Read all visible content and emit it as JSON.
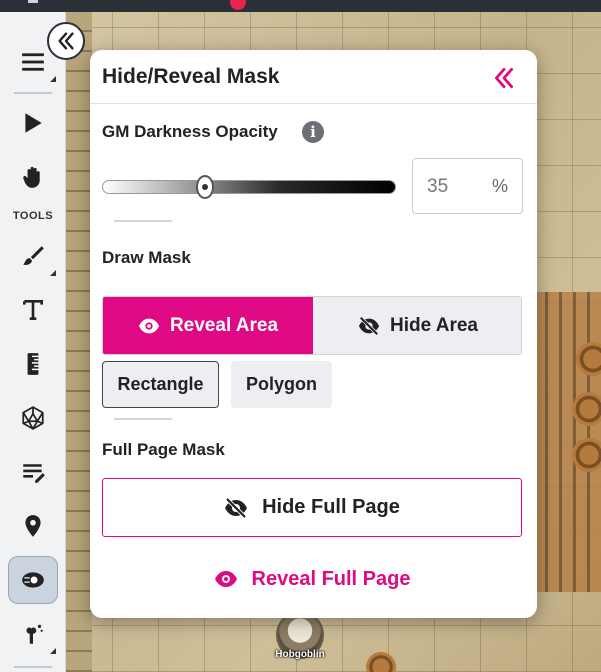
{
  "colors": {
    "accent": "#df0a83",
    "panel_bg": "#ffffff",
    "toolbar_bg": "#f1f2f4"
  },
  "toolbar": {
    "tools_label": "TOOLS",
    "items": [
      {
        "icon": "menu-icon"
      },
      {
        "icon": "pointer-icon"
      },
      {
        "icon": "hand-icon"
      },
      {
        "icon": "brush-icon"
      },
      {
        "icon": "text-icon"
      },
      {
        "icon": "ruler-icon"
      },
      {
        "icon": "d20-dice-icon"
      },
      {
        "icon": "notes-icon"
      },
      {
        "icon": "map-pin-icon"
      },
      {
        "icon": "fog-mask-icon",
        "active": true
      },
      {
        "icon": "fx-icon"
      }
    ]
  },
  "map": {
    "token_label": "Hobgoblin"
  },
  "panel": {
    "title": "Hide/Reveal Mask",
    "opacity": {
      "label": "GM Darkness Opacity",
      "value": "35",
      "unit": "%",
      "slider_fraction": 0.35
    },
    "draw_mask": {
      "label": "Draw Mask",
      "reveal_label": "Reveal Area",
      "hide_label": "Hide Area",
      "selected": "Reveal Area",
      "shapes": [
        "Rectangle",
        "Polygon"
      ],
      "selected_shape": "Rectangle"
    },
    "full_page": {
      "label": "Full Page Mask",
      "hide_label": "Hide Full Page",
      "reveal_label": "Reveal Full Page"
    }
  }
}
